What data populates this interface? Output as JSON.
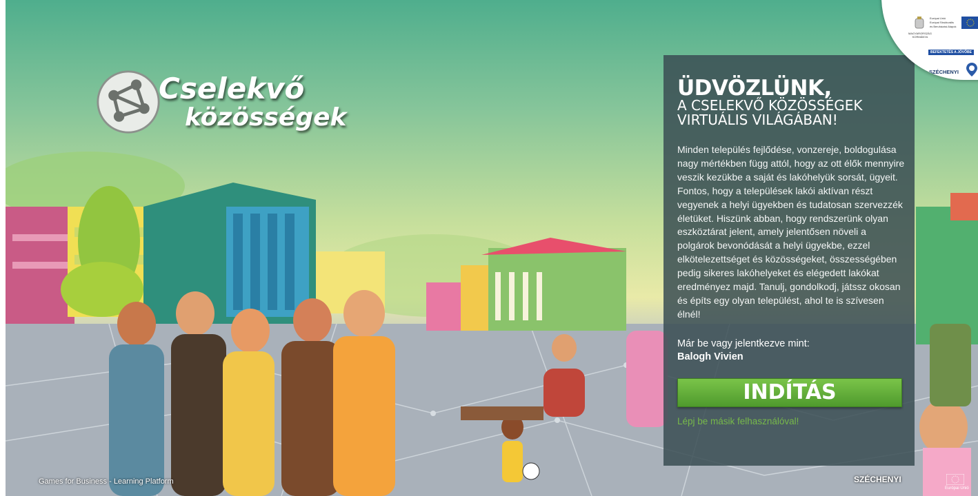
{
  "logo": {
    "line1": "Cselekvő",
    "line2": "közösségek"
  },
  "welcome": {
    "title": "ÜDVÖZLÜNK,",
    "subtitle": "A CSELEKVŐ KÖZÖSSÉGEK VIRTUÁLIS VILÁGÁBAN!",
    "body": "Minden település fejlődése, vonzereje, boldogulása nagy mértékben függ attól, hogy az ott élők mennyire veszik kezükbe a saját és lakóhelyük sorsát, ügyeit. Fontos, hogy a települések lakói aktívan részt vegyenek a helyi ügyekben és tudatosan szervezzék életüket. Hiszünk abban, hogy rendszerünk olyan eszköztárat jelent, amely jelentősen növeli a polgárok bevonódását a helyi ügyekbe, ezzel elkötelezettséget és közösségeket, összességében pedig sikeres lakóhelyeket és elégedett lakókat eredményez majd. Tanulj, gondolkodj, játssz okosan és építs egy olyan települést, ahol te is szívesen élnél!",
    "logged_in_label": "Már be vagy jelentkezve mint:",
    "username": "Balogh Vivien",
    "start_button": "INDÍTÁS",
    "switch_user_link": "Lépj be másik felhasználóval!"
  },
  "eu_badge": {
    "gov_label": "MAGYARORSZÁG KORMÁNYA",
    "eu_line1": "Európai Unió",
    "eu_line2": "Európai Strukturális",
    "eu_line3": "és Beruházási Alapok",
    "invest": "BEFEKTETÉS A JÖVŐBE",
    "szechenyi": "SZÉCHENYI"
  },
  "footer": {
    "platform": "Games for Business - Learning Platform",
    "szechenyi": "SZÉCHENYI",
    "eu": "Európai Unió"
  },
  "colors": {
    "panel_bg": "#3a4e54",
    "start_button": "#5fa83a",
    "switch_link": "#77b84a",
    "eu_blue": "#1f4fa2"
  }
}
